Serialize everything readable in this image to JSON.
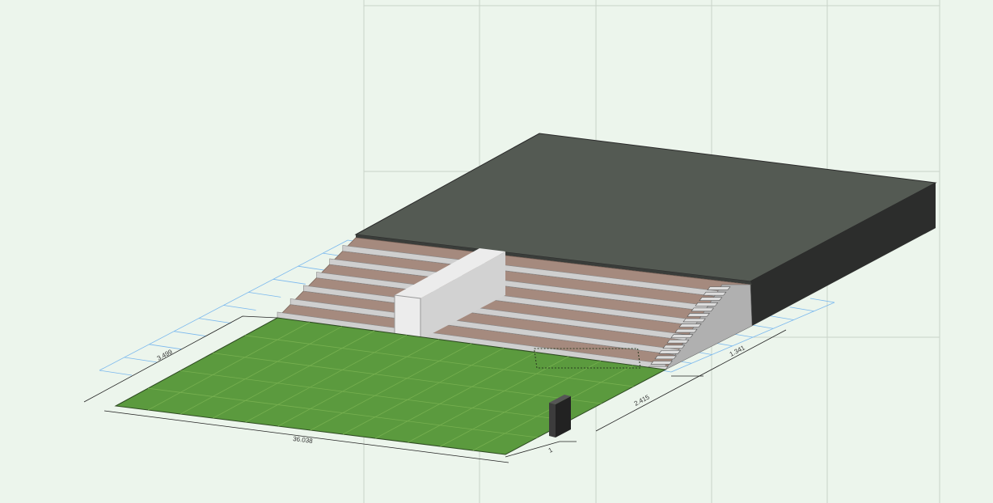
{
  "view": {
    "background": "#ecf5ec",
    "grid_color": "#c9d2c9"
  },
  "model": {
    "roof_color": "#545a53",
    "roof_side_color": "#2c2d2c",
    "seat_tread_color": "#a58a7e",
    "seat_riser_color": "#cfcfcf",
    "field_color": "#5b9a3e",
    "aisle_wall_color": "#ececec",
    "stair_color": "#dddddd",
    "marker_color": "#3c3c3c",
    "blueprint_line_color": "#7ab8ee"
  },
  "dimensions": {
    "field_length": "36.038",
    "field_width": "3.499",
    "side_depth": "2.415",
    "stair_width": "1.341",
    "corner_offset": "1"
  }
}
